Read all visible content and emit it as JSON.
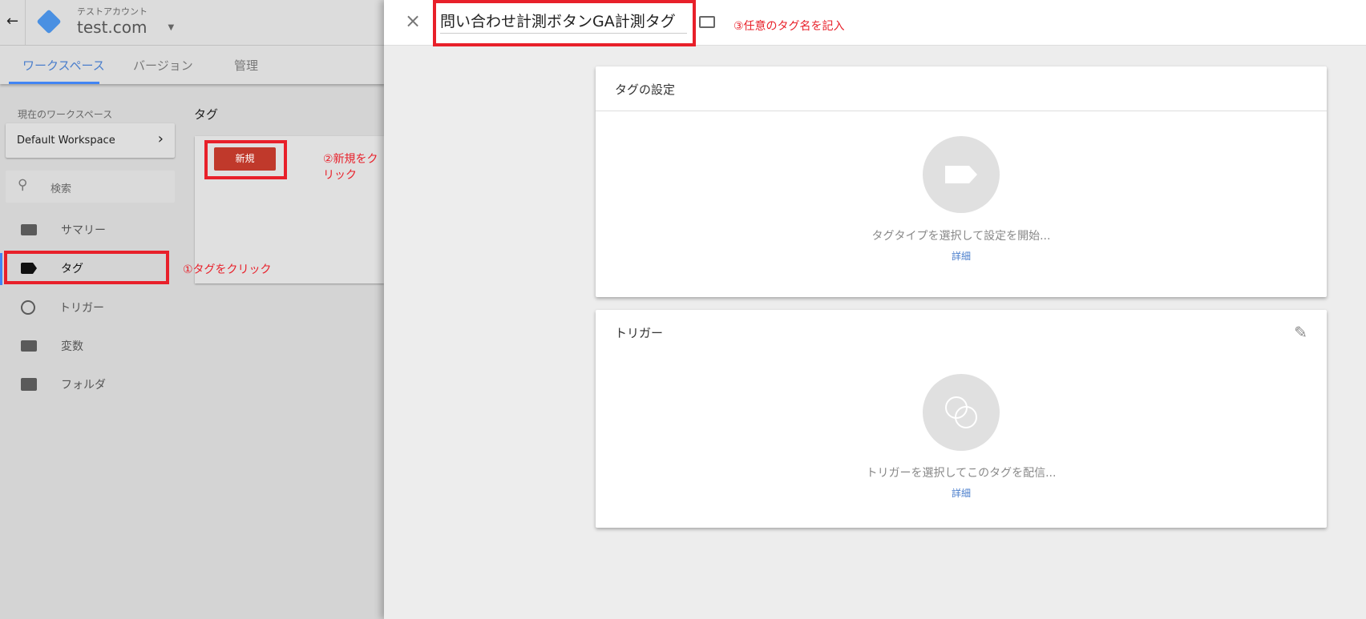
{
  "header": {
    "account": "テストアカウント",
    "container": "test.com"
  },
  "tabs": [
    {
      "label": "ワークスペース",
      "active": true
    },
    {
      "label": "バージョン"
    },
    {
      "label": "管理"
    }
  ],
  "sidebar": {
    "workspace_label": "現在のワークスペース",
    "workspace": "Default Workspace",
    "search_placeholder": "検索",
    "items": [
      {
        "label": "サマリー",
        "icon": "summary-icon"
      },
      {
        "label": "タグ",
        "icon": "tag-icon",
        "active": true
      },
      {
        "label": "トリガー",
        "icon": "trigger-icon"
      },
      {
        "label": "変数",
        "icon": "variable-icon"
      },
      {
        "label": "フォルダ",
        "icon": "folder-icon"
      }
    ]
  },
  "main": {
    "title": "タグ",
    "new_button": "新規"
  },
  "annotations": {
    "step1": "①タグをクリック",
    "step2": "②新規をクリック",
    "step3": "③任意のタグ名を記入"
  },
  "panel": {
    "tag_name": "問い合わせ計測ボタンGA計測タグ",
    "tag_config": {
      "title": "タグの設定",
      "hint": "タグタイプを選択して設定を開始...",
      "link": "詳細"
    },
    "trigger": {
      "title": "トリガー",
      "hint": "トリガーを選択してこのタグを配信...",
      "link": "詳細"
    }
  },
  "colors": {
    "accent": "#4285f4",
    "new_button": "#c0392b",
    "annotation": "#e8202a"
  }
}
